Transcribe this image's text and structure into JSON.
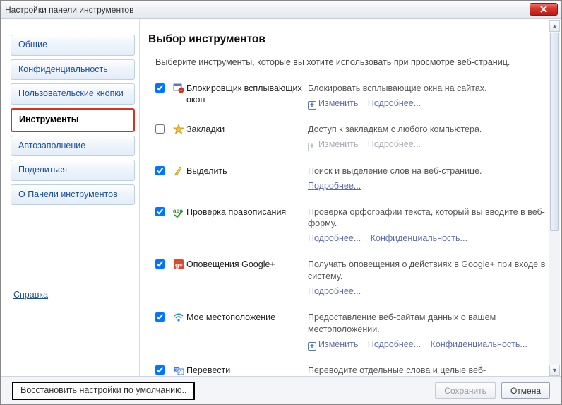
{
  "window": {
    "title": "Настройки панели инструментов"
  },
  "sidebar": {
    "items": [
      {
        "label": "Общие"
      },
      {
        "label": "Конфиденциальность"
      },
      {
        "label": "Пользовательские кнопки"
      },
      {
        "label": "Инструменты"
      },
      {
        "label": "Автозаполнение"
      },
      {
        "label": "Поделиться"
      },
      {
        "label": "О Панели инструментов"
      }
    ],
    "help": "Справка"
  },
  "main": {
    "heading": "Выбор инструментов",
    "subtitle": "Выберите инструменты, которые вы хотите использовать при просмотре веб-страниц.",
    "links": {
      "edit": "Изменить",
      "more": "Подробнее...",
      "privacy": "Конфиденциальность..."
    },
    "tools": [
      {
        "name": "Блокировщик всплывающих окон",
        "checked": true,
        "desc": "Блокировать всплывающие окна на сайтах.",
        "edit": true,
        "more": true,
        "privacy": false
      },
      {
        "name": "Закладки",
        "checked": false,
        "desc": "Доступ к закладкам с любого компьютера.",
        "edit": true,
        "editDisabled": true,
        "more": true,
        "moreDisabled": true,
        "privacy": false
      },
      {
        "name": "Выделить",
        "checked": true,
        "desc": "Поиск и выделение слов на веб-странице.",
        "edit": false,
        "more": true,
        "privacy": false
      },
      {
        "name": "Проверка правописания",
        "checked": true,
        "desc": "Проверка орфографии текста, который вы вводите в веб-форму.",
        "edit": false,
        "more": true,
        "privacy": true
      },
      {
        "name": "Оповещения Google+",
        "checked": true,
        "desc": "Получать оповещения о действиях в Google+ при входе в систему.",
        "edit": false,
        "more": true,
        "privacy": false
      },
      {
        "name": "Мое местоположение",
        "checked": true,
        "desc": "Предоставление веб-сайтам данных о вашем местоположении.",
        "edit": true,
        "more": true,
        "privacy": true
      },
      {
        "name": "Перевести",
        "checked": true,
        "desc": "Переводите отдельные слова и целые веб-",
        "edit": false,
        "more": false,
        "privacy": false
      }
    ]
  },
  "footer": {
    "restore": "Восстановить настройки по умолчанию..",
    "save": "Сохранить",
    "cancel": "Отмена"
  }
}
